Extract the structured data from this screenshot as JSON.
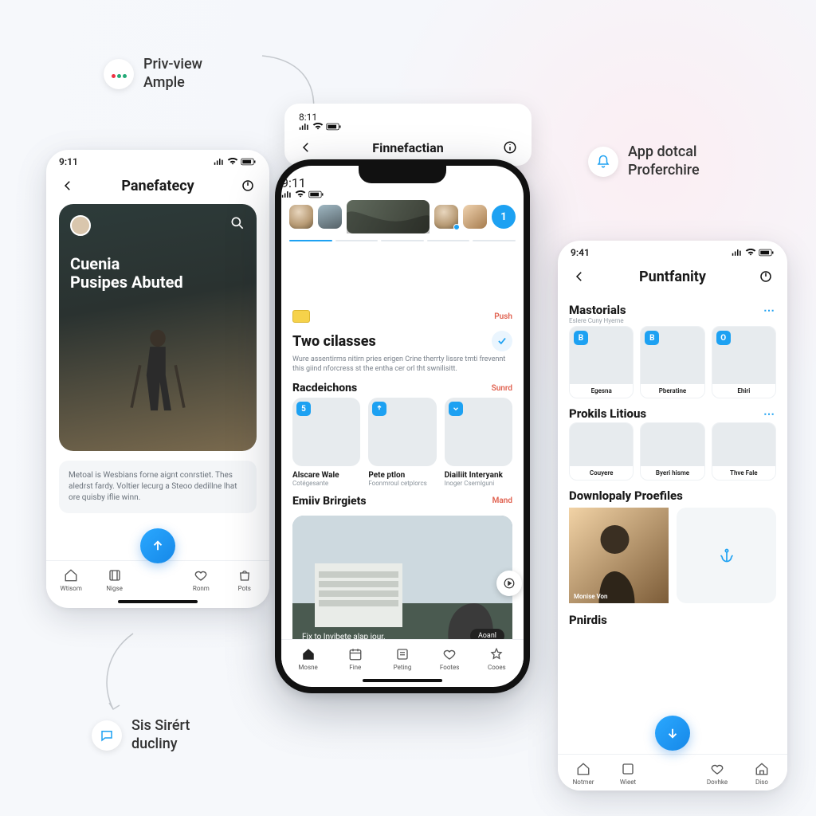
{
  "annotations": {
    "top": {
      "line1": "Priv-view",
      "line2": "Ample"
    },
    "right": {
      "line1": "App dotcal",
      "line2": "Proferchire"
    },
    "bottom": {
      "line1": "Sis Sirért",
      "line2": "ducliny"
    }
  },
  "phone1": {
    "status_time": "9:11",
    "title": "Panefatecy",
    "hero": {
      "line1": "Cuenia",
      "line2": "Pusipes Abuted"
    },
    "caption": "Metoal is Wesbians forne aignt conrstiet. Thes aledrst fardy. Voltier lecurg a Steoo dedillne lhat ore quisby iflie winn.",
    "tabs": [
      "Wtisom",
      "Nigse",
      "",
      "Ronm",
      "Pots"
    ]
  },
  "phone2": {
    "floater_time": "8:11",
    "floater_title": "Finnefactian",
    "bubble_count": "1",
    "status_time": "9:11",
    "badge_label": "Push",
    "sec1_title": "Two cilasses",
    "sec1_body": "Wure assentirms nitirn pries erigen Crine therrty lissre tmti frevennt this giind nforcress st the entha cer orl tht swnilisitt.",
    "sec2_title": "Racdeichons",
    "sec2_more": "Sunrd",
    "cards": [
      {
        "title": "Alscare Wale",
        "sub": "Cotégesante"
      },
      {
        "title": "Pete ptlon",
        "sub": "Foonmroul cetplorcs"
      },
      {
        "title": "Diailiit Interyank",
        "sub": "Inoger Csernlguni"
      }
    ],
    "sec3_title": "Emiiv Brirgiets",
    "sec3_more": "Mand",
    "bigcard_caption": "Fix to Invibete alap jour.",
    "bigcard_pill": "Aoanl",
    "tabs": [
      "Mosne",
      "Fine",
      "Peting",
      "Footes",
      "Cooes"
    ]
  },
  "phone3": {
    "status_time": "9:41",
    "title": "Puntfanity",
    "sec1_title": "Mastorials",
    "sec1_sub": "Eslere Cuny Hyerne",
    "grid1": [
      {
        "name": "Egesna"
      },
      {
        "name": "Pberatine"
      },
      {
        "name": "Ehiri"
      }
    ],
    "sec2_title": "Prokils Litious",
    "grid2": [
      {
        "name": "Couyere"
      },
      {
        "name": "Byeri hisme"
      },
      {
        "name": "Thve Fale"
      }
    ],
    "sec3_title": "Downlopaly Proefiles",
    "wide_caption": "Monise Von",
    "sec4_title": "Pnirdis",
    "tabs": [
      "Notmer",
      "Wieet",
      "",
      "Dovhke",
      "Diso"
    ]
  }
}
